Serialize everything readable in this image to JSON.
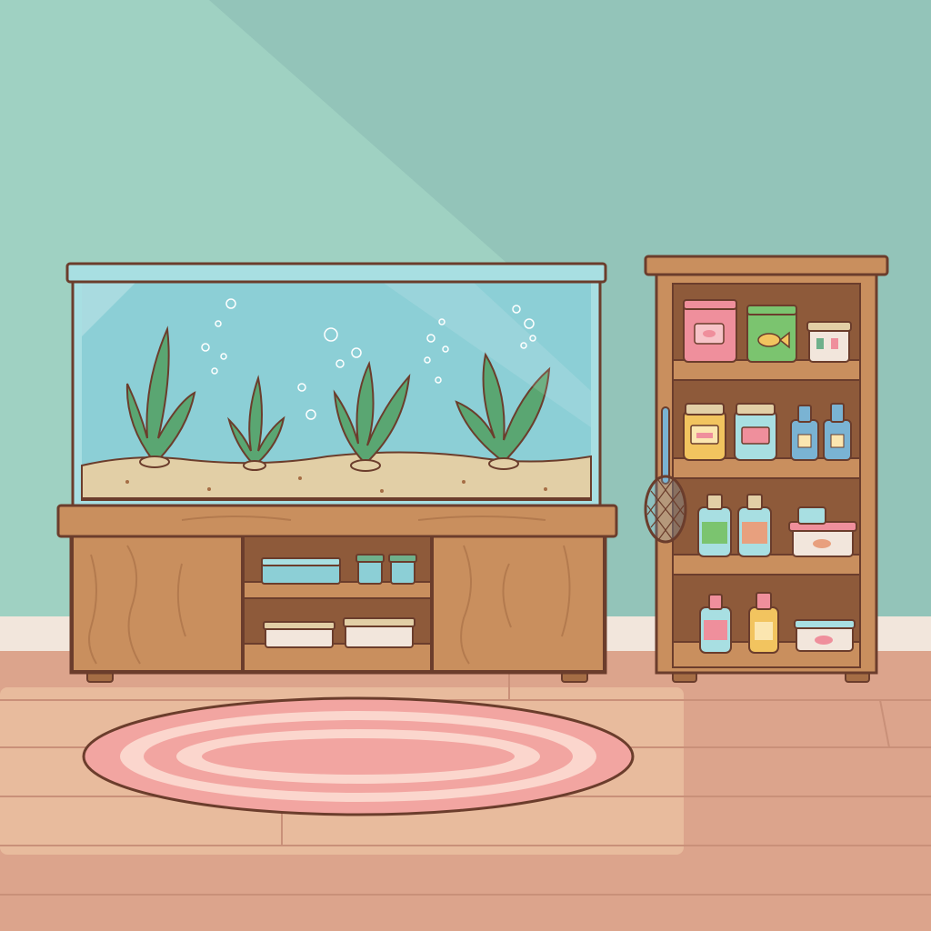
{
  "scene": {
    "name": "aquarium-room",
    "description_hidden": false
  },
  "colors": {
    "wall": "#93c4b9",
    "wall_light": "#a9dccb",
    "baseboard": "#f2e6dc",
    "floor": "#dca48c",
    "floor_light": "#ecc4a4",
    "floor_line": "#c99079",
    "outline": "#6b3d2c",
    "wood": "#c98f5e",
    "wood_dark": "#a56d45",
    "wood_inner": "#8e5a3a",
    "water": "#8ccfd6",
    "water_dark": "#72bec8",
    "glass_rim": "#a8dfe2",
    "sand": "#e2cfa6",
    "plant": "#5aa672",
    "plant_dark": "#3f8457",
    "rug_outer": "#f2a5a1",
    "rug_light": "#fbd6cd",
    "pink": "#ef8f9c",
    "green_bag": "#7bc46f",
    "yellow": "#f2c45f",
    "bottle_blue": "#7ab3d3",
    "lid_green": "#6fb08b"
  },
  "icons": {
    "food_bag_pink": "food-bag-icon",
    "food_bag_green": "fish-food-bag-icon",
    "jar": "jar-icon",
    "bottle": "bottle-icon",
    "net": "fish-net-icon",
    "container": "container-icon"
  }
}
